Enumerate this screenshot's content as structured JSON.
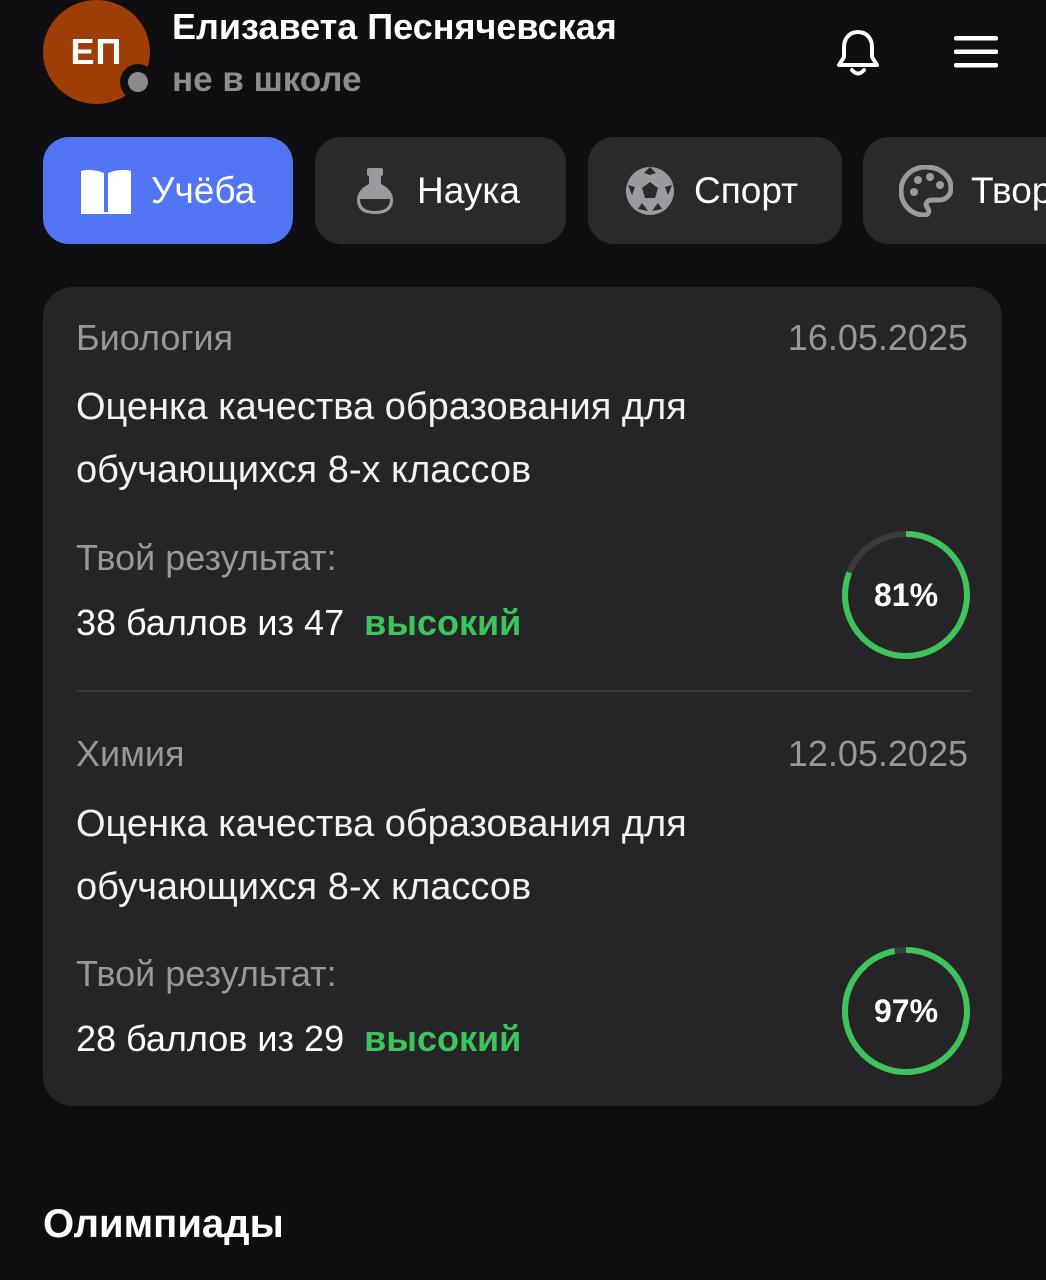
{
  "user": {
    "initials": "ЕП",
    "name": "Елизавета Песнячевская",
    "status": "не в школе"
  },
  "tabs": [
    {
      "label": "Учёба",
      "icon": "book-icon",
      "active": true
    },
    {
      "label": "Наука",
      "icon": "flask-icon",
      "active": false
    },
    {
      "label": "Спорт",
      "icon": "soccer-ball-icon",
      "active": false
    },
    {
      "label": "Твор",
      "icon": "palette-icon",
      "active": false
    }
  ],
  "results": [
    {
      "subject": "Биология",
      "date": "16.05.2025",
      "title": "Оценка качества образования для обучающихся 8-х классов",
      "result_label": "Твой результат:",
      "score": "38 баллов из 47",
      "level": "высокий",
      "percent_text": "81%",
      "percent": 81
    },
    {
      "subject": "Химия",
      "date": "12.05.2025",
      "title": "Оценка качества образования для обучающихся 8-х классов",
      "result_label": "Твой результат:",
      "score": "28 баллов из 29",
      "level": "высокий",
      "percent_text": "97%",
      "percent": 97
    }
  ],
  "sections": {
    "olympiads_title": "Олимпиады"
  },
  "colors": {
    "accent": "#5175f5",
    "avatar": "#9e3e06",
    "success": "#3ec45a",
    "card": "#252527",
    "background": "#0f0f11"
  }
}
